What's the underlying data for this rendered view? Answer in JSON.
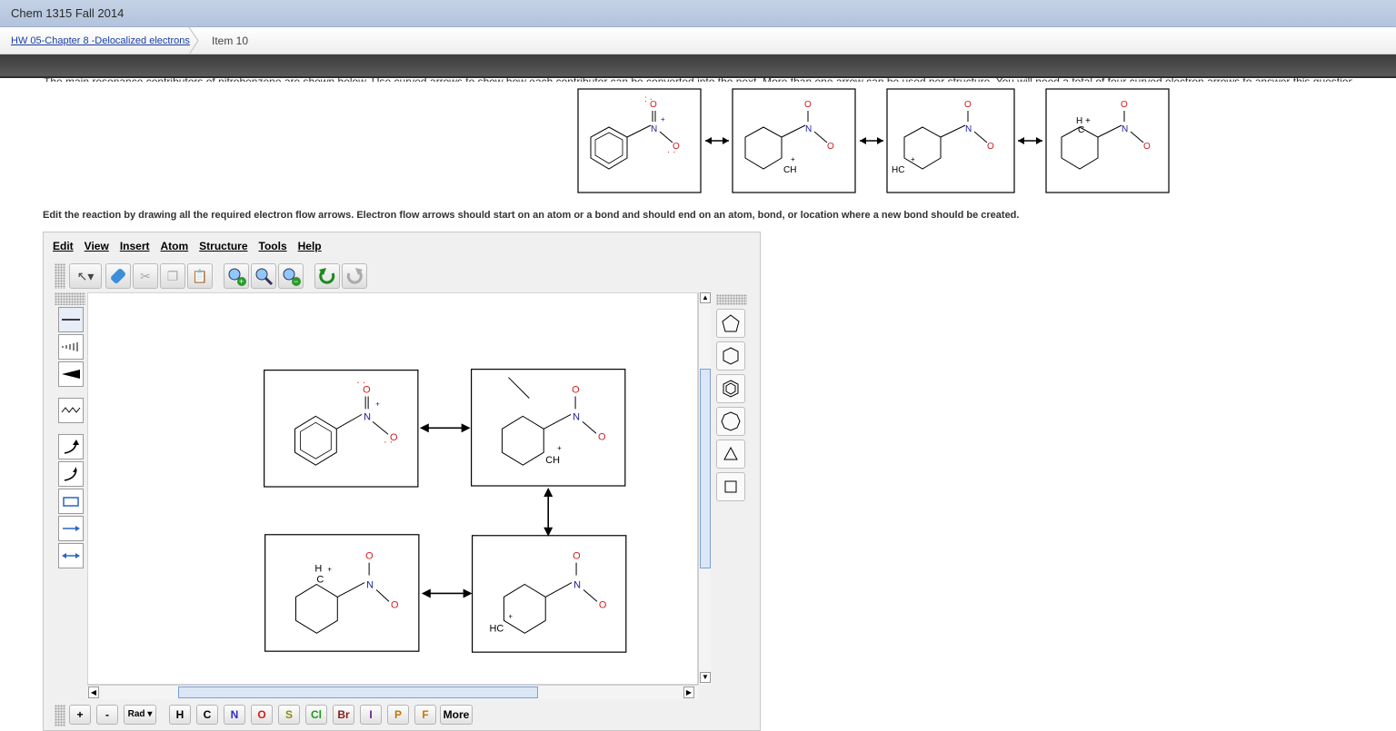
{
  "window": {
    "title": "Chem 1315 Fall 2014"
  },
  "breadcrumb": {
    "link": "HW 05-Chapter 8 -Delocalized electrons",
    "current": "Item 10"
  },
  "question": {
    "intro_partial": "The main resonance contributors of nitrobenzene are shown below. Use curved arrows to show how each contributor can be converted into the next. More than one arrow can be used per structure. You will need a total of four curved electron arrows to answer this question.",
    "instruction": "Edit the reaction by drawing all the required electron flow arrows. Electron flow arrows should start on an atom or a bond and should end on an atom, bond, or location where a new bond should be created."
  },
  "editor": {
    "menu": [
      "Edit",
      "View",
      "Insert",
      "Atom",
      "Structure",
      "Tools",
      "Help"
    ],
    "toolbar_icons": [
      "select-arrow-icon",
      "eraser-icon",
      "scissors-icon",
      "copy-icon",
      "paste-icon",
      "zoom-in-icon",
      "zoom-fit-icon",
      "zoom-out-icon",
      "undo-icon",
      "redo-icon"
    ],
    "left_tools": [
      "single-bond-tool-icon",
      "hashed-bond-tool-icon",
      "wedge-bond-tool-icon",
      "wavy-bond-tool-icon",
      "curved-arrow-full-icon",
      "curved-arrow-half-icon",
      "rectangle-tool-icon",
      "reaction-arrow-icon",
      "resonance-arrow-icon"
    ],
    "shape_tools": [
      "cyclopentane-icon",
      "cyclohexane-icon",
      "benzene-icon",
      "cycloheptane-icon",
      "cyclopropane-icon",
      "cyclobutane-icon"
    ],
    "atom_buttons": [
      {
        "label": "+",
        "color": "#333333"
      },
      {
        "label": "-",
        "color": "#333333"
      },
      {
        "label": "Rad",
        "color": "#333333"
      },
      {
        "label": "H",
        "color": "#333333"
      },
      {
        "label": "C",
        "color": "#333333"
      },
      {
        "label": "N",
        "color": "#2b2bd0"
      },
      {
        "label": "O",
        "color": "#d41b1b"
      },
      {
        "label": "S",
        "color": "#8c8c14"
      },
      {
        "label": "Cl",
        "color": "#1b9a1b"
      },
      {
        "label": "Br",
        "color": "#8b1a1a"
      },
      {
        "label": "I",
        "color": "#6a1b9a"
      },
      {
        "label": "P",
        "color": "#c17a00"
      },
      {
        "label": "F",
        "color": "#c17a00"
      },
      {
        "label": "More",
        "color": "#333333"
      }
    ],
    "molecule_labels": {
      "n": "N",
      "o": "O",
      "ch": "CH",
      "hc": "HC",
      "h": "H",
      "c": "C",
      "plus": "+",
      "minus": "-"
    }
  },
  "colors": {
    "oxygen": "#d41b1b",
    "nitrogen": "#1a1a9e",
    "charge_plus": "#1a1a9e"
  }
}
